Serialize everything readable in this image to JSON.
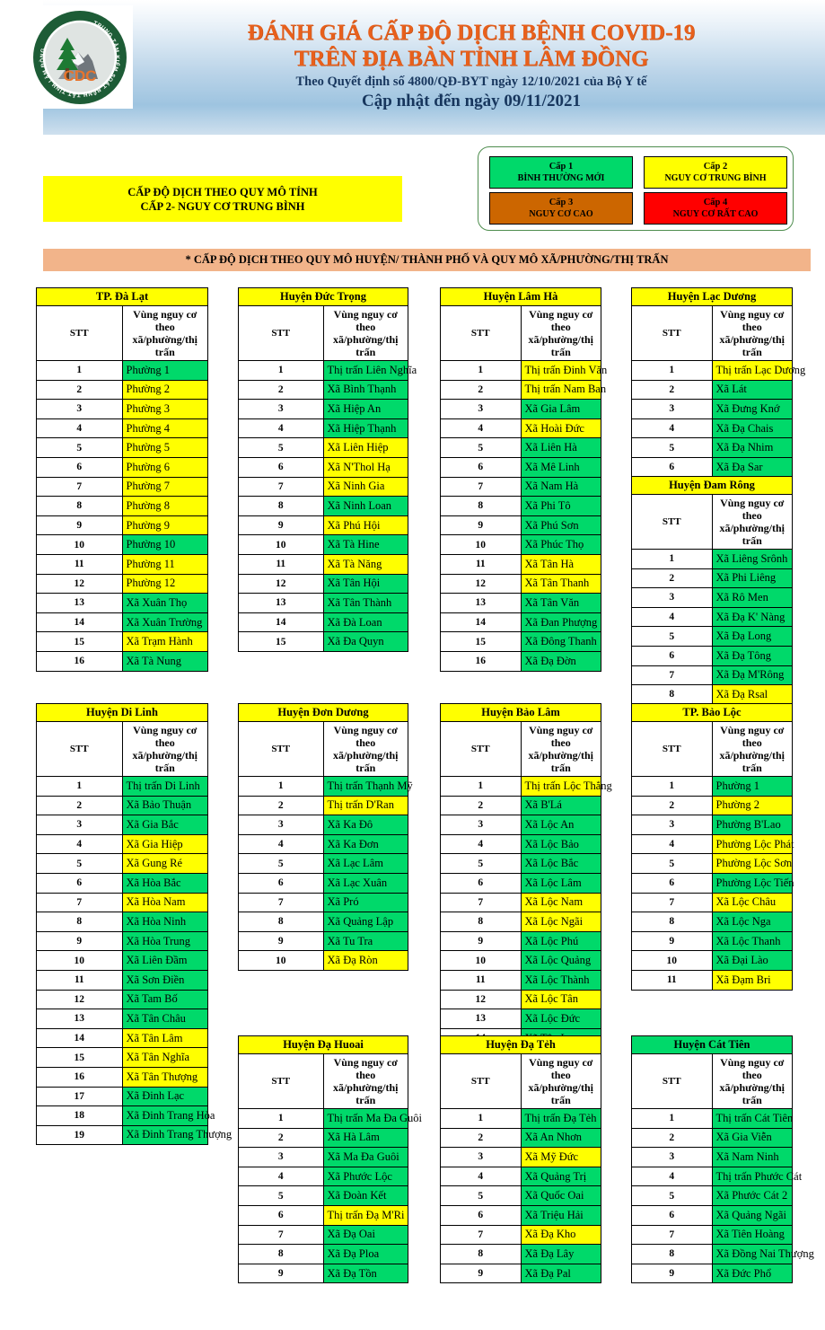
{
  "header": {
    "title_line1": "ĐÁNH GIÁ CẤP ĐỘ DỊCH BỆNH COVID-19",
    "title_line2": "TRÊN ĐỊA BÀN TỈNH LÂM ĐỒNG",
    "subtitle": "Theo Quyết định  số 4800/QĐ-BYT ngày 12/10/2021 của Bộ Y tế",
    "updated": "Cập nhật đến ngày 09/11/2021",
    "logo_text": "CDC",
    "logo_ring_text": "TRUNG TÂM KIỂM SOÁT BỆNH TẬT TỈNH LÂM ĐỒNG"
  },
  "province_level": {
    "line1": "CẤP ĐỘ DỊCH THEO QUY MÔ TỈNH",
    "line2": "CẤP 2- NGUY CƠ TRUNG BÌNH",
    "bg": "#FFFF00"
  },
  "legend": {
    "items": [
      {
        "level": "Cấp 1",
        "label": "BÌNH THƯỜNG MỚI",
        "color": "#00D96A"
      },
      {
        "level": "Cấp 2",
        "label": "NGUY CƠ TRUNG BÌNH",
        "color": "#FFFF00"
      },
      {
        "level": "Cấp 3",
        "label": "NGUY CƠ CAO",
        "color": "#CC6600"
      },
      {
        "level": "Cấp 4",
        "label": "NGUY CƠ RẤT CAO",
        "color": "#FF0000"
      }
    ]
  },
  "subtitle_bar": {
    "text": "* CẤP ĐỘ DỊCH THEO QUY MÔ HUYỆN/ THÀNH PHỐ VÀ QUY MÔ XÃ/PHƯỜNG/THỊ TRẤN",
    "bg": "#F2B48A"
  },
  "columns": {
    "stt": "STT",
    "zone": "Vùng nguy cơ theo xã/phường/thị trấn",
    "zone_l1": "Vùng nguy cơ theo",
    "zone_l2": "xã/phường/thị trấn"
  },
  "tables": [
    {
      "id": "dalat",
      "title": "TP. Đà Lạt",
      "title_level": 2,
      "rows": [
        {
          "n": "1",
          "name": "Phường 1",
          "level": 1
        },
        {
          "n": "2",
          "name": "Phường 2",
          "level": 2
        },
        {
          "n": "3",
          "name": "Phường 3",
          "level": 2
        },
        {
          "n": "4",
          "name": "Phường 4",
          "level": 2
        },
        {
          "n": "5",
          "name": "Phường 5",
          "level": 2
        },
        {
          "n": "6",
          "name": "Phường 6",
          "level": 2
        },
        {
          "n": "7",
          "name": "Phường 7",
          "level": 2
        },
        {
          "n": "8",
          "name": "Phường 8",
          "level": 2
        },
        {
          "n": "9",
          "name": "Phường 9",
          "level": 2
        },
        {
          "n": "10",
          "name": "Phường 10",
          "level": 1
        },
        {
          "n": "11",
          "name": "Phường 11",
          "level": 2
        },
        {
          "n": "12",
          "name": "Phường 12",
          "level": 2
        },
        {
          "n": "13",
          "name": "Xã Xuân Thọ",
          "level": 1
        },
        {
          "n": "14",
          "name": "Xã Xuân Trường",
          "level": 1
        },
        {
          "n": "15",
          "name": "Xã Trạm Hành",
          "level": 2
        },
        {
          "n": "16",
          "name": "Xã Tà Nung",
          "level": 1
        }
      ]
    },
    {
      "id": "ductrong",
      "title": "Huyện Đức Trọng",
      "title_level": 2,
      "rows": [
        {
          "n": "1",
          "name": "Thị trấn Liên Nghĩa",
          "level": 1
        },
        {
          "n": "2",
          "name": "Xã Bình Thạnh",
          "level": 1
        },
        {
          "n": "3",
          "name": "Xã Hiệp An",
          "level": 1
        },
        {
          "n": "4",
          "name": "Xã Hiệp Thạnh",
          "level": 1
        },
        {
          "n": "5",
          "name": "Xã Liên Hiệp",
          "level": 2
        },
        {
          "n": "6",
          "name": "Xã N'Thol Hạ",
          "level": 2
        },
        {
          "n": "7",
          "name": "Xã Ninh Gia",
          "level": 2
        },
        {
          "n": "8",
          "name": "Xã Ninh Loan",
          "level": 1
        },
        {
          "n": "9",
          "name": "Xã Phú Hội",
          "level": 2
        },
        {
          "n": "10",
          "name": "Xã Tà Hine",
          "level": 1
        },
        {
          "n": "11",
          "name": "Xã Tà Năng",
          "level": 2
        },
        {
          "n": "12",
          "name": "Xã Tân Hội",
          "level": 1
        },
        {
          "n": "13",
          "name": "Xã Tân Thành",
          "level": 1
        },
        {
          "n": "14",
          "name": "Xã Đà Loan",
          "level": 1
        },
        {
          "n": "15",
          "name": "Xã Đa Quyn",
          "level": 1
        }
      ]
    },
    {
      "id": "lamha",
      "title": "Huyện Lâm Hà",
      "title_level": 2,
      "rows": [
        {
          "n": "1",
          "name": "Thị trấn Đinh Văn",
          "level": 2
        },
        {
          "n": "2",
          "name": "Thị trấn Nam Ban",
          "level": 2
        },
        {
          "n": "3",
          "name": "Xã Gia Lâm",
          "level": 1
        },
        {
          "n": "4",
          "name": "Xã Hoài Đức",
          "level": 2
        },
        {
          "n": "5",
          "name": "Xã Liên Hà",
          "level": 1
        },
        {
          "n": "6",
          "name": "Xã Mê Linh",
          "level": 1
        },
        {
          "n": "7",
          "name": "Xã Nam Hà",
          "level": 1
        },
        {
          "n": "8",
          "name": "Xã Phi Tô",
          "level": 1
        },
        {
          "n": "9",
          "name": "Xã Phú Sơn",
          "level": 1
        },
        {
          "n": "10",
          "name": "Xã Phúc Thọ",
          "level": 1
        },
        {
          "n": "11",
          "name": "Xã Tân Hà",
          "level": 2
        },
        {
          "n": "12",
          "name": "Xã Tân Thanh",
          "level": 2
        },
        {
          "n": "13",
          "name": "Xã Tân Văn",
          "level": 1
        },
        {
          "n": "14",
          "name": "Xã Đan Phượng",
          "level": 1
        },
        {
          "n": "15",
          "name": "Xã Đông Thanh",
          "level": 1
        },
        {
          "n": "16",
          "name": "Xã Đạ Đờn",
          "level": 1
        }
      ]
    },
    {
      "id": "lacduong",
      "title": "Huyện Lạc Dương",
      "title_level": 2,
      "rows": [
        {
          "n": "1",
          "name": "Thị trấn Lạc Dương",
          "level": 2
        },
        {
          "n": "2",
          "name": "Xã Lát",
          "level": 1
        },
        {
          "n": "3",
          "name": "Xã Đưng Knớ",
          "level": 1
        },
        {
          "n": "4",
          "name": "Xã Đạ Chais",
          "level": 1
        },
        {
          "n": "5",
          "name": "Xã Đạ Nhim",
          "level": 1
        },
        {
          "n": "6",
          "name": "Xã Đạ Sar",
          "level": 1
        }
      ]
    },
    {
      "id": "damrong",
      "title": "Huyện Đam Rông",
      "title_level": 2,
      "rows": [
        {
          "n": "1",
          "name": "Xã Liêng Srônh",
          "level": 1
        },
        {
          "n": "2",
          "name": "Xã Phi Liêng",
          "level": 1
        },
        {
          "n": "3",
          "name": "Xã Rô Men",
          "level": 1
        },
        {
          "n": "4",
          "name": "Xã Đạ K' Nàng",
          "level": 1
        },
        {
          "n": "5",
          "name": "Xã Đạ Long",
          "level": 1
        },
        {
          "n": "6",
          "name": "Xã Đạ Tông",
          "level": 1
        },
        {
          "n": "7",
          "name": "Xã Đạ M'Rông",
          "level": 1
        },
        {
          "n": "8",
          "name": "Xã Đạ Rsal",
          "level": 2
        }
      ]
    },
    {
      "id": "dilinh",
      "title": "Huyện Di Linh",
      "title_level": 2,
      "rows": [
        {
          "n": "1",
          "name": "Thị trấn Di Linh",
          "level": 1
        },
        {
          "n": "2",
          "name": "Xã Bảo Thuận",
          "level": 1
        },
        {
          "n": "3",
          "name": "Xã Gia Bắc",
          "level": 1
        },
        {
          "n": "4",
          "name": "Xã Gia Hiệp",
          "level": 2
        },
        {
          "n": "5",
          "name": "Xã Gung Ré",
          "level": 2
        },
        {
          "n": "6",
          "name": "Xã Hòa Bắc",
          "level": 1
        },
        {
          "n": "7",
          "name": "Xã Hòa Nam",
          "level": 2
        },
        {
          "n": "8",
          "name": "Xã Hòa Ninh",
          "level": 1
        },
        {
          "n": "9",
          "name": "Xã Hòa Trung",
          "level": 1
        },
        {
          "n": "10",
          "name": "Xã Liên Đầm",
          "level": 1
        },
        {
          "n": "11",
          "name": "Xã Sơn Điền",
          "level": 1
        },
        {
          "n": "12",
          "name": "Xã Tam Bố",
          "level": 1
        },
        {
          "n": "13",
          "name": "Xã Tân Châu",
          "level": 1
        },
        {
          "n": "14",
          "name": "Xã Tân Lâm",
          "level": 2
        },
        {
          "n": "15",
          "name": "Xã Tân Nghĩa",
          "level": 2
        },
        {
          "n": "16",
          "name": "Xã Tân Thượng",
          "level": 2
        },
        {
          "n": "17",
          "name": "Xã Đinh Lạc",
          "level": 1
        },
        {
          "n": "18",
          "name": "Xã Đinh Trang Hòa",
          "level": 1
        },
        {
          "n": "19",
          "name": "Xã Đinh Trang Thượng",
          "level": 1
        }
      ]
    },
    {
      "id": "donduong",
      "title": "Huyện Đơn Dương",
      "title_level": 2,
      "rows": [
        {
          "n": "1",
          "name": "Thị trấn Thạnh Mỹ",
          "level": 1
        },
        {
          "n": "2",
          "name": "Thị trấn D'Ran",
          "level": 2
        },
        {
          "n": "3",
          "name": "Xã Ka Đô",
          "level": 1
        },
        {
          "n": "4",
          "name": "Xã Ka Đơn",
          "level": 1
        },
        {
          "n": "5",
          "name": "Xã Lạc Lâm",
          "level": 1
        },
        {
          "n": "6",
          "name": "Xã Lạc Xuân",
          "level": 1
        },
        {
          "n": "7",
          "name": "Xã Pró",
          "level": 1
        },
        {
          "n": "8",
          "name": "Xã Quảng Lập",
          "level": 1
        },
        {
          "n": "9",
          "name": "Xã Tu Tra",
          "level": 1
        },
        {
          "n": "10",
          "name": "Xã Đạ Ròn",
          "level": 2
        }
      ]
    },
    {
      "id": "baolam",
      "title": "Huyện Bảo Lâm",
      "title_level": 2,
      "rows": [
        {
          "n": "1",
          "name": "Thị trấn Lộc Thắng",
          "level": 2
        },
        {
          "n": "2",
          "name": "Xã B'Lá",
          "level": 1
        },
        {
          "n": "3",
          "name": "Xã Lộc An",
          "level": 1
        },
        {
          "n": "4",
          "name": "Xã Lộc Bảo",
          "level": 1
        },
        {
          "n": "5",
          "name": "Xã Lộc Bắc",
          "level": 1
        },
        {
          "n": "6",
          "name": "Xã Lộc Lâm",
          "level": 1
        },
        {
          "n": "7",
          "name": "Xã Lộc Nam",
          "level": 2
        },
        {
          "n": "8",
          "name": "Xã Lộc Ngãi",
          "level": 2
        },
        {
          "n": "9",
          "name": "Xã Lộc Phú",
          "level": 1
        },
        {
          "n": "10",
          "name": "Xã Lộc Quảng",
          "level": 1
        },
        {
          "n": "11",
          "name": "Xã Lộc Thành",
          "level": 1
        },
        {
          "n": "12",
          "name": "Xã Lộc Tân",
          "level": 2
        },
        {
          "n": "13",
          "name": "Xã Lộc Đức",
          "level": 1
        },
        {
          "n": "14",
          "name": "Xã Tân Lạc",
          "level": 1
        }
      ]
    },
    {
      "id": "baoloc",
      "title": "TP. Bảo Lộc",
      "title_level": 2,
      "rows": [
        {
          "n": "1",
          "name": "Phường 1",
          "level": 1
        },
        {
          "n": "2",
          "name": "Phường 2",
          "level": 2
        },
        {
          "n": "3",
          "name": "Phường B'Lao",
          "level": 1
        },
        {
          "n": "4",
          "name": "Phường Lộc Phát",
          "level": 2
        },
        {
          "n": "5",
          "name": "Phường Lộc Sơn",
          "level": 2
        },
        {
          "n": "6",
          "name": "Phường Lộc Tiến",
          "level": 1
        },
        {
          "n": "7",
          "name": "Xã Lộc Châu",
          "level": 2
        },
        {
          "n": "8",
          "name": "Xã Lộc Nga",
          "level": 1
        },
        {
          "n": "9",
          "name": "Xã Lộc Thanh",
          "level": 1
        },
        {
          "n": "10",
          "name": "Xã Đại Lào",
          "level": 1
        },
        {
          "n": "11",
          "name": "Xã Đạm Bri",
          "level": 2
        }
      ]
    },
    {
      "id": "dahuoai",
      "title": "Huyện Đạ Huoai",
      "title_level": 2,
      "rows": [
        {
          "n": "1",
          "name": "Thị trấn Ma Đa Guôi",
          "level": 1
        },
        {
          "n": "2",
          "name": "Xã Hà Lâm",
          "level": 1
        },
        {
          "n": "3",
          "name": "Xã Ma Đa Guôi",
          "level": 1
        },
        {
          "n": "4",
          "name": "Xã Phước Lộc",
          "level": 1
        },
        {
          "n": "5",
          "name": "Xã Đoàn Kết",
          "level": 1
        },
        {
          "n": "6",
          "name": "Thị trấn Đạ M'Ri",
          "level": 2
        },
        {
          "n": "7",
          "name": "Xã Đạ Oai",
          "level": 1
        },
        {
          "n": "8",
          "name": "Xã Đạ Ploa",
          "level": 1
        },
        {
          "n": "9",
          "name": "Xã Đạ Tồn",
          "level": 1
        }
      ]
    },
    {
      "id": "dateh",
      "title": "Huyện Đạ Tẻh",
      "title_level": 2,
      "rows": [
        {
          "n": "1",
          "name": "Thị trấn Đạ Tẻh",
          "level": 1
        },
        {
          "n": "2",
          "name": "Xã An Nhơn",
          "level": 1
        },
        {
          "n": "3",
          "name": "Xã Mỹ Đức",
          "level": 2
        },
        {
          "n": "4",
          "name": "Xã Quảng Trị",
          "level": 1
        },
        {
          "n": "5",
          "name": "Xã Quốc Oai",
          "level": 1
        },
        {
          "n": "6",
          "name": "Xã Triệu Hải",
          "level": 1
        },
        {
          "n": "7",
          "name": "Xã Đạ Kho",
          "level": 2
        },
        {
          "n": "8",
          "name": "Xã Đạ Lây",
          "level": 1
        },
        {
          "n": "9",
          "name": "Xã Đạ Pal",
          "level": 1
        }
      ]
    },
    {
      "id": "cattien",
      "title": "Huyện Cát Tiên",
      "title_level": 1,
      "rows": [
        {
          "n": "1",
          "name": "Thị trấn Cát Tiên",
          "level": 1
        },
        {
          "n": "2",
          "name": "Xã Gia Viễn",
          "level": 1
        },
        {
          "n": "3",
          "name": "Xã Nam Ninh",
          "level": 1
        },
        {
          "n": "4",
          "name": "Thị trấn Phước Cát",
          "level": 1
        },
        {
          "n": "5",
          "name": "Xã Phước Cát 2",
          "level": 1
        },
        {
          "n": "6",
          "name": "Xã Quảng Ngãi",
          "level": 1
        },
        {
          "n": "7",
          "name": "Xã Tiên Hoàng",
          "level": 1
        },
        {
          "n": "8",
          "name": "Xã Đồng Nai Thượng",
          "level": 1
        },
        {
          "n": "9",
          "name": "Xã Đức Phổ",
          "level": 1
        }
      ]
    }
  ]
}
